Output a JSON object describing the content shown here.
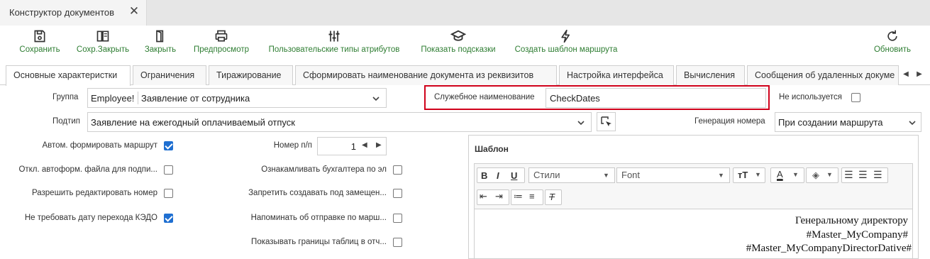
{
  "doc_tab": {
    "title": "Конструктор документов"
  },
  "toolbar": {
    "save": "Сохранить",
    "save_close": "Сохр.Закрыть",
    "close": "Закрыть",
    "preview": "Предпросмотр",
    "attr_types": "Пользовательские типы атрибутов",
    "hints": "Показать подсказки",
    "route_template": "Создать шаблон маршрута",
    "refresh": "Обновить"
  },
  "tabs": [
    "Основные характеристки",
    "Ограничения",
    "Тиражирование",
    "Сформировать наименование документа из реквизитов",
    "Настройка интерфейса",
    "Вычисления",
    "Сообщения об удаленных докуме"
  ],
  "form": {
    "group_label": "Группа",
    "group_code": "Employee!",
    "group_value": "Заявление от сотрудника",
    "service_name_label": "Служебное наименование",
    "service_name_value": "CheckDates",
    "not_used_label": "Не используется",
    "subtype_label": "Подтип",
    "subtype_value": "Заявление на ежегодный оплачиваемый отпуск",
    "number_gen_label": "Генерация номера",
    "number_gen_value": "При создании маршрута",
    "auto_route_label": "Автом. формировать маршрут",
    "auto_route_checked": true,
    "order_num_label": "Номер п/п",
    "order_num_value": "1",
    "disable_autofile_label": "Откл. автоформ. файла для подпи...",
    "disable_autofile_checked": false,
    "acquaint_accountant_label": "Ознакамливать бухгалтера по эл",
    "acquaint_accountant_checked": false,
    "allow_edit_number_label": "Разрешить редактировать номер",
    "allow_edit_number_checked": false,
    "forbid_create_label": "Запретить создавать под замещен...",
    "forbid_create_checked": false,
    "no_kedo_date_label": "Не требовать дату перехода КЭДО",
    "no_kedo_date_checked": true,
    "remind_send_label": "Напоминать об отправке по марш...",
    "remind_send_checked": false,
    "show_borders_label": "Показывать границы таблиц в отч...",
    "show_borders_checked": false
  },
  "template": {
    "title": "Шаблон",
    "styles_placeholder": "Стили",
    "font_placeholder": "Font",
    "lines": [
      "Генеральному директору",
      "#Master_MyCompany#",
      "#Master_MyCompanyDirectorDative#"
    ]
  },
  "colors": {
    "accent_green": "#2e7d32",
    "highlight_red": "#d0021b",
    "checkbox_blue": "#1f6fd1"
  }
}
